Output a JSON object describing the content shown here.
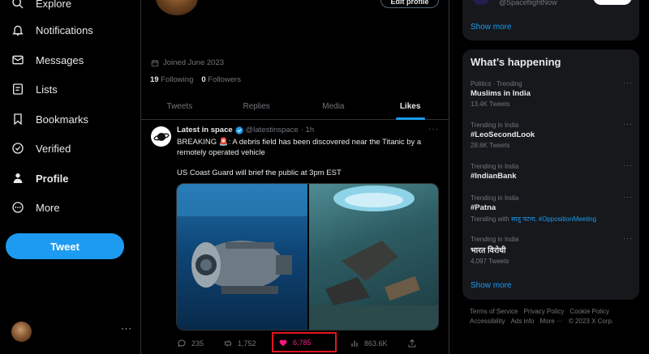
{
  "nav": {
    "items": [
      {
        "label": "Explore",
        "icon": "search-icon"
      },
      {
        "label": "Notifications",
        "icon": "bell-icon"
      },
      {
        "label": "Messages",
        "icon": "mail-icon"
      },
      {
        "label": "Lists",
        "icon": "list-icon"
      },
      {
        "label": "Bookmarks",
        "icon": "bookmark-icon"
      },
      {
        "label": "Verified",
        "icon": "verified-icon"
      },
      {
        "label": "Profile",
        "icon": "person-icon"
      },
      {
        "label": "More",
        "icon": "more-circle-icon"
      }
    ],
    "tweet_button": "Tweet",
    "account_more": "···"
  },
  "profile": {
    "edit_button": "Edit profile",
    "joined": "Joined June 2023",
    "following_count": "19",
    "following_label": "Following",
    "followers_count": "0",
    "followers_label": "Followers",
    "tabs": [
      {
        "label": "Tweets",
        "active": false
      },
      {
        "label": "Replies",
        "active": false
      },
      {
        "label": "Media",
        "active": false
      },
      {
        "label": "Likes",
        "active": true
      }
    ]
  },
  "tweet": {
    "name": "Latest in space",
    "handle": "@latestinspace",
    "time": "· 1h",
    "more": "···",
    "text_line": "BREAKING 🚨: A debris field has been discovered near the Titanic by a remotely operated vehicle",
    "text_line2": "US Coast Guard will brief the public at 3pm EST",
    "replies": "235",
    "retweets": "1,752",
    "likes": "6,785",
    "views": "863.6K"
  },
  "right": {
    "top_handle": "@SpaceflightNow",
    "top_show_more": "Show more",
    "trends_title": "What’s happening",
    "trends": [
      {
        "meta": "Politics · Trending",
        "title": "Muslims in India",
        "sub": "13.4K Tweets"
      },
      {
        "meta": "Trending in India",
        "title": "#LeoSecondLook",
        "sub": "28.6K Tweets"
      },
      {
        "meta": "Trending in India",
        "title": "#IndianBank",
        "sub": ""
      },
      {
        "meta": "Trending in India",
        "title": "#Patna",
        "sub_prefix": "Trending with ",
        "sub_links": "सातु पटना, #OppositionMeeting"
      },
      {
        "meta": "Trending in India",
        "title": "भारत विरोधी",
        "sub": "4,097 Tweets"
      }
    ],
    "trend_more": "···",
    "trends_show_more": "Show more",
    "footer": [
      "Terms of Service",
      "Privacy Policy",
      "Cookie Policy",
      "Accessibility",
      "Ads info",
      "More ···",
      "© 2023 X Corp."
    ]
  },
  "colors": {
    "accent": "#1d9bf0",
    "like": "#f91880",
    "highlight_box": "#e0161f",
    "card_bg": "#16181c"
  }
}
